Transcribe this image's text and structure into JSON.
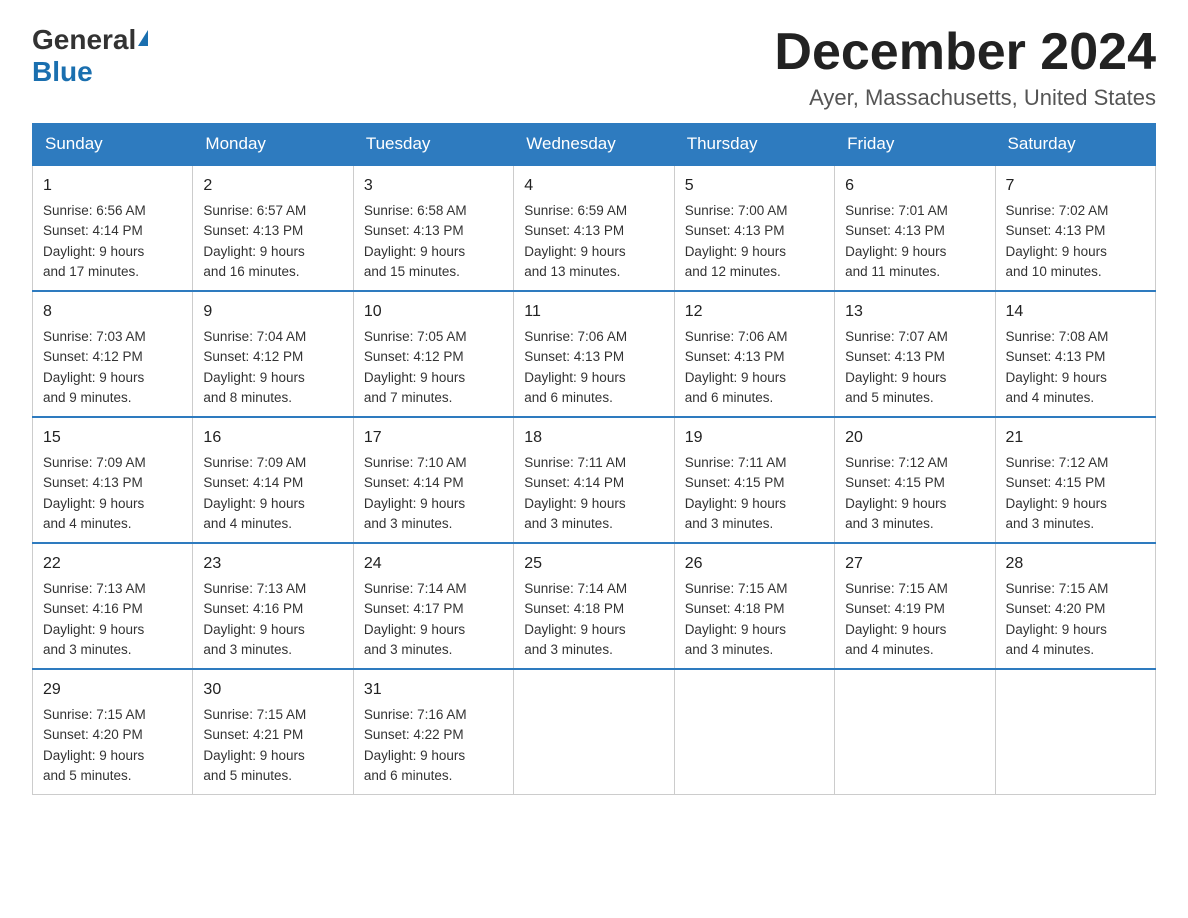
{
  "logo": {
    "general": "General",
    "blue": "Blue"
  },
  "header": {
    "month_year": "December 2024",
    "location": "Ayer, Massachusetts, United States"
  },
  "days_of_week": [
    "Sunday",
    "Monday",
    "Tuesday",
    "Wednesday",
    "Thursday",
    "Friday",
    "Saturday"
  ],
  "weeks": [
    [
      {
        "day": "1",
        "sunrise": "6:56 AM",
        "sunset": "4:14 PM",
        "daylight": "9 hours and 17 minutes."
      },
      {
        "day": "2",
        "sunrise": "6:57 AM",
        "sunset": "4:13 PM",
        "daylight": "9 hours and 16 minutes."
      },
      {
        "day": "3",
        "sunrise": "6:58 AM",
        "sunset": "4:13 PM",
        "daylight": "9 hours and 15 minutes."
      },
      {
        "day": "4",
        "sunrise": "6:59 AM",
        "sunset": "4:13 PM",
        "daylight": "9 hours and 13 minutes."
      },
      {
        "day": "5",
        "sunrise": "7:00 AM",
        "sunset": "4:13 PM",
        "daylight": "9 hours and 12 minutes."
      },
      {
        "day": "6",
        "sunrise": "7:01 AM",
        "sunset": "4:13 PM",
        "daylight": "9 hours and 11 minutes."
      },
      {
        "day": "7",
        "sunrise": "7:02 AM",
        "sunset": "4:13 PM",
        "daylight": "9 hours and 10 minutes."
      }
    ],
    [
      {
        "day": "8",
        "sunrise": "7:03 AM",
        "sunset": "4:12 PM",
        "daylight": "9 hours and 9 minutes."
      },
      {
        "day": "9",
        "sunrise": "7:04 AM",
        "sunset": "4:12 PM",
        "daylight": "9 hours and 8 minutes."
      },
      {
        "day": "10",
        "sunrise": "7:05 AM",
        "sunset": "4:12 PM",
        "daylight": "9 hours and 7 minutes."
      },
      {
        "day": "11",
        "sunrise": "7:06 AM",
        "sunset": "4:13 PM",
        "daylight": "9 hours and 6 minutes."
      },
      {
        "day": "12",
        "sunrise": "7:06 AM",
        "sunset": "4:13 PM",
        "daylight": "9 hours and 6 minutes."
      },
      {
        "day": "13",
        "sunrise": "7:07 AM",
        "sunset": "4:13 PM",
        "daylight": "9 hours and 5 minutes."
      },
      {
        "day": "14",
        "sunrise": "7:08 AM",
        "sunset": "4:13 PM",
        "daylight": "9 hours and 4 minutes."
      }
    ],
    [
      {
        "day": "15",
        "sunrise": "7:09 AM",
        "sunset": "4:13 PM",
        "daylight": "9 hours and 4 minutes."
      },
      {
        "day": "16",
        "sunrise": "7:09 AM",
        "sunset": "4:14 PM",
        "daylight": "9 hours and 4 minutes."
      },
      {
        "day": "17",
        "sunrise": "7:10 AM",
        "sunset": "4:14 PM",
        "daylight": "9 hours and 3 minutes."
      },
      {
        "day": "18",
        "sunrise": "7:11 AM",
        "sunset": "4:14 PM",
        "daylight": "9 hours and 3 minutes."
      },
      {
        "day": "19",
        "sunrise": "7:11 AM",
        "sunset": "4:15 PM",
        "daylight": "9 hours and 3 minutes."
      },
      {
        "day": "20",
        "sunrise": "7:12 AM",
        "sunset": "4:15 PM",
        "daylight": "9 hours and 3 minutes."
      },
      {
        "day": "21",
        "sunrise": "7:12 AM",
        "sunset": "4:15 PM",
        "daylight": "9 hours and 3 minutes."
      }
    ],
    [
      {
        "day": "22",
        "sunrise": "7:13 AM",
        "sunset": "4:16 PM",
        "daylight": "9 hours and 3 minutes."
      },
      {
        "day": "23",
        "sunrise": "7:13 AM",
        "sunset": "4:16 PM",
        "daylight": "9 hours and 3 minutes."
      },
      {
        "day": "24",
        "sunrise": "7:14 AM",
        "sunset": "4:17 PM",
        "daylight": "9 hours and 3 minutes."
      },
      {
        "day": "25",
        "sunrise": "7:14 AM",
        "sunset": "4:18 PM",
        "daylight": "9 hours and 3 minutes."
      },
      {
        "day": "26",
        "sunrise": "7:15 AM",
        "sunset": "4:18 PM",
        "daylight": "9 hours and 3 minutes."
      },
      {
        "day": "27",
        "sunrise": "7:15 AM",
        "sunset": "4:19 PM",
        "daylight": "9 hours and 4 minutes."
      },
      {
        "day": "28",
        "sunrise": "7:15 AM",
        "sunset": "4:20 PM",
        "daylight": "9 hours and 4 minutes."
      }
    ],
    [
      {
        "day": "29",
        "sunrise": "7:15 AM",
        "sunset": "4:20 PM",
        "daylight": "9 hours and 5 minutes."
      },
      {
        "day": "30",
        "sunrise": "7:15 AM",
        "sunset": "4:21 PM",
        "daylight": "9 hours and 5 minutes."
      },
      {
        "day": "31",
        "sunrise": "7:16 AM",
        "sunset": "4:22 PM",
        "daylight": "9 hours and 6 minutes."
      },
      null,
      null,
      null,
      null
    ]
  ],
  "labels": {
    "sunrise": "Sunrise:",
    "sunset": "Sunset:",
    "daylight": "Daylight:"
  }
}
